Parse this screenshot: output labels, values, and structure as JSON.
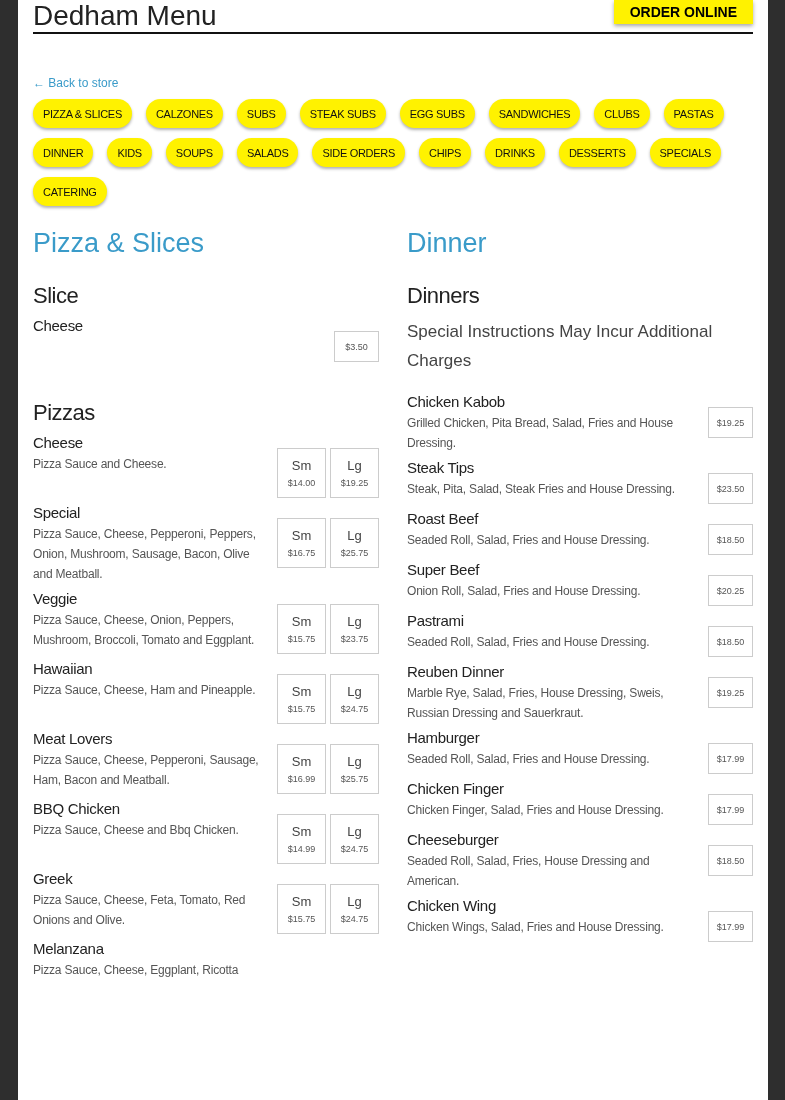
{
  "header": {
    "title": "Dedham Menu",
    "order_button": "ORDER ONLINE"
  },
  "back_link": "← Back to store",
  "categories": [
    {
      "label": "PIZZA & SLICES"
    },
    {
      "label": "CALZONES"
    },
    {
      "label": "SUBS"
    },
    {
      "label": "STEAK SUBS"
    },
    {
      "label": "EGG SUBS"
    },
    {
      "label": "SANDWICHES"
    },
    {
      "label": "CLUBS"
    },
    {
      "label": "PASTAS"
    },
    {
      "label": "DINNER"
    },
    {
      "label": "KIDS"
    },
    {
      "label": "SOUPS"
    },
    {
      "label": "SALADS"
    },
    {
      "label": "SIDE ORDERS"
    },
    {
      "label": "CHIPS"
    },
    {
      "label": "DRINKS"
    },
    {
      "label": "DESSERTS"
    },
    {
      "label": "SPECIALS"
    },
    {
      "label": "CATERING"
    }
  ],
  "columns": [
    {
      "title": "Pizza & Slices",
      "groups": [
        {
          "title": "Slice",
          "items": [
            {
              "name": "Cheese",
              "prices": [
                {
                  "price": "$3.50"
                }
              ]
            }
          ]
        },
        {
          "title": "Pizzas",
          "items": [
            {
              "name": "Cheese",
              "description": "Pizza Sauce and Cheese.",
              "prices": [
                {
                  "size": "Sm",
                  "price": "$14.00"
                },
                {
                  "size": "Lg",
                  "price": "$19.25"
                }
              ]
            },
            {
              "name": "Special",
              "description": "Pizza Sauce, Cheese, Pepperoni, Peppers, Onion, Mushroom, Sausage, Bacon, Olive and Meatball.",
              "prices": [
                {
                  "size": "Sm",
                  "price": "$16.75"
                },
                {
                  "size": "Lg",
                  "price": "$25.75"
                }
              ]
            },
            {
              "name": "Veggie",
              "description": "Pizza Sauce, Cheese, Onion, Peppers, Mushroom, Broccoli, Tomato and Eggplant.",
              "prices": [
                {
                  "size": "Sm",
                  "price": "$15.75"
                },
                {
                  "size": "Lg",
                  "price": "$23.75"
                }
              ]
            },
            {
              "name": "Hawaiian",
              "description": "Pizza Sauce, Cheese, Ham and Pineapple.",
              "prices": [
                {
                  "size": "Sm",
                  "price": "$15.75"
                },
                {
                  "size": "Lg",
                  "price": "$24.75"
                }
              ]
            },
            {
              "name": "Meat Lovers",
              "description": "Pizza Sauce, Cheese, Pepperoni, Sausage, Ham, Bacon and Meatball.",
              "prices": [
                {
                  "size": "Sm",
                  "price": "$16.99"
                },
                {
                  "size": "Lg",
                  "price": "$25.75"
                }
              ]
            },
            {
              "name": "BBQ Chicken",
              "description": "Pizza Sauce, Cheese and Bbq Chicken.",
              "prices": [
                {
                  "size": "Sm",
                  "price": "$14.99"
                },
                {
                  "size": "Lg",
                  "price": "$24.75"
                }
              ]
            },
            {
              "name": "Greek",
              "description": "Pizza Sauce, Cheese, Feta, Tomato, Red Onions and Olive.",
              "prices": [
                {
                  "size": "Sm",
                  "price": "$15.75"
                },
                {
                  "size": "Lg",
                  "price": "$24.75"
                }
              ]
            },
            {
              "name": "Melanzana",
              "description": "Pizza Sauce, Cheese, Eggplant, Ricotta"
            }
          ]
        }
      ]
    },
    {
      "title": "Dinner",
      "groups": [
        {
          "title": "Dinners",
          "note": "Special Instructions May Incur Additional Charges",
          "items": [
            {
              "name": "Chicken Kabob",
              "description": "Grilled Chicken, Pita Bread, Salad, Fries and House Dressing.",
              "prices": [
                {
                  "price": "$19.25"
                }
              ]
            },
            {
              "name": "Steak Tips",
              "description": "Steak, Pita, Salad, Steak Fries and House Dressing.",
              "prices": [
                {
                  "price": "$23.50"
                }
              ]
            },
            {
              "name": "Roast Beef",
              "description": "Seaded Roll, Salad, Fries and House Dressing.",
              "prices": [
                {
                  "price": "$18.50"
                }
              ]
            },
            {
              "name": "Super Beef",
              "description": "Onion Roll, Salad, Fries and House Dressing.",
              "prices": [
                {
                  "price": "$20.25"
                }
              ]
            },
            {
              "name": "Pastrami",
              "description": "Seaded Roll, Salad, Fries and House Dressing.",
              "prices": [
                {
                  "price": "$18.50"
                }
              ]
            },
            {
              "name": "Reuben Dinner",
              "description": "Marble Rye, Salad, Fries, House Dressing, Sweis, Russian Dressing and Sauerkraut.",
              "prices": [
                {
                  "price": "$19.25"
                }
              ]
            },
            {
              "name": "Hamburger",
              "description": "Seaded Roll, Salad, Fries and House Dressing.",
              "prices": [
                {
                  "price": "$17.99"
                }
              ]
            },
            {
              "name": "Chicken Finger",
              "description": "Chicken Finger, Salad, Fries and House Dressing.",
              "prices": [
                {
                  "price": "$17.99"
                }
              ]
            },
            {
              "name": "Cheeseburger",
              "description": "Seaded Roll, Salad, Fries, House Dressing and American.",
              "prices": [
                {
                  "price": "$18.50"
                }
              ]
            },
            {
              "name": "Chicken Wing",
              "description": "Chicken Wings, Salad, Fries and House Dressing.",
              "prices": [
                {
                  "price": "$17.99"
                }
              ]
            }
          ]
        }
      ]
    }
  ]
}
